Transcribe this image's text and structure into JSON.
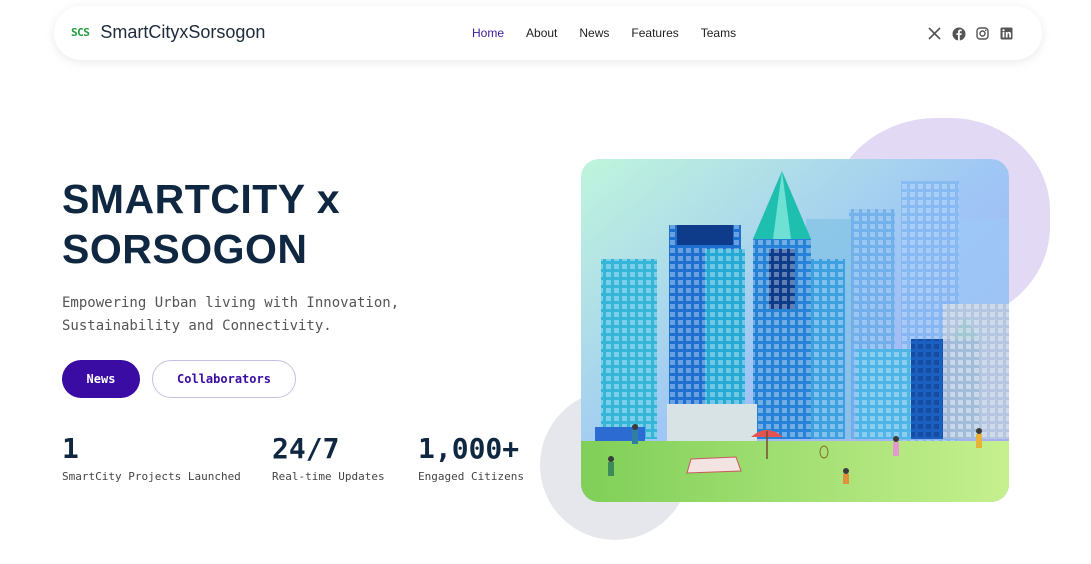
{
  "nav": {
    "logo_text": "SCS",
    "brand": "SmartCityxSorsogon",
    "links": [
      "Home",
      "About",
      "News",
      "Features",
      "Teams"
    ],
    "active": "Home",
    "socials": [
      "x-icon",
      "facebook-icon",
      "instagram-icon",
      "linkedin-icon"
    ]
  },
  "hero": {
    "title_line1": "SMARTCITY x",
    "title_line2": "SORSOGON",
    "subtitle_line1": "Empowering Urban living with Innovation,",
    "subtitle_line2": "Sustainability and Connectivity.",
    "primary_button": "News",
    "secondary_button": "Collaborators"
  },
  "stats": [
    {
      "value": "1",
      "label": "SmartCity Projects Launched"
    },
    {
      "value": "24/7",
      "label": "Real-time Updates"
    },
    {
      "value": "1,000+",
      "label": "Engaged Citizens"
    }
  ],
  "colors": {
    "accent": "#3a0ca3",
    "title": "#0f2740",
    "logo_green": "#1f9d3a",
    "blob_purple": "#e2d9f4",
    "blob_gray": "#e6e7ec"
  }
}
